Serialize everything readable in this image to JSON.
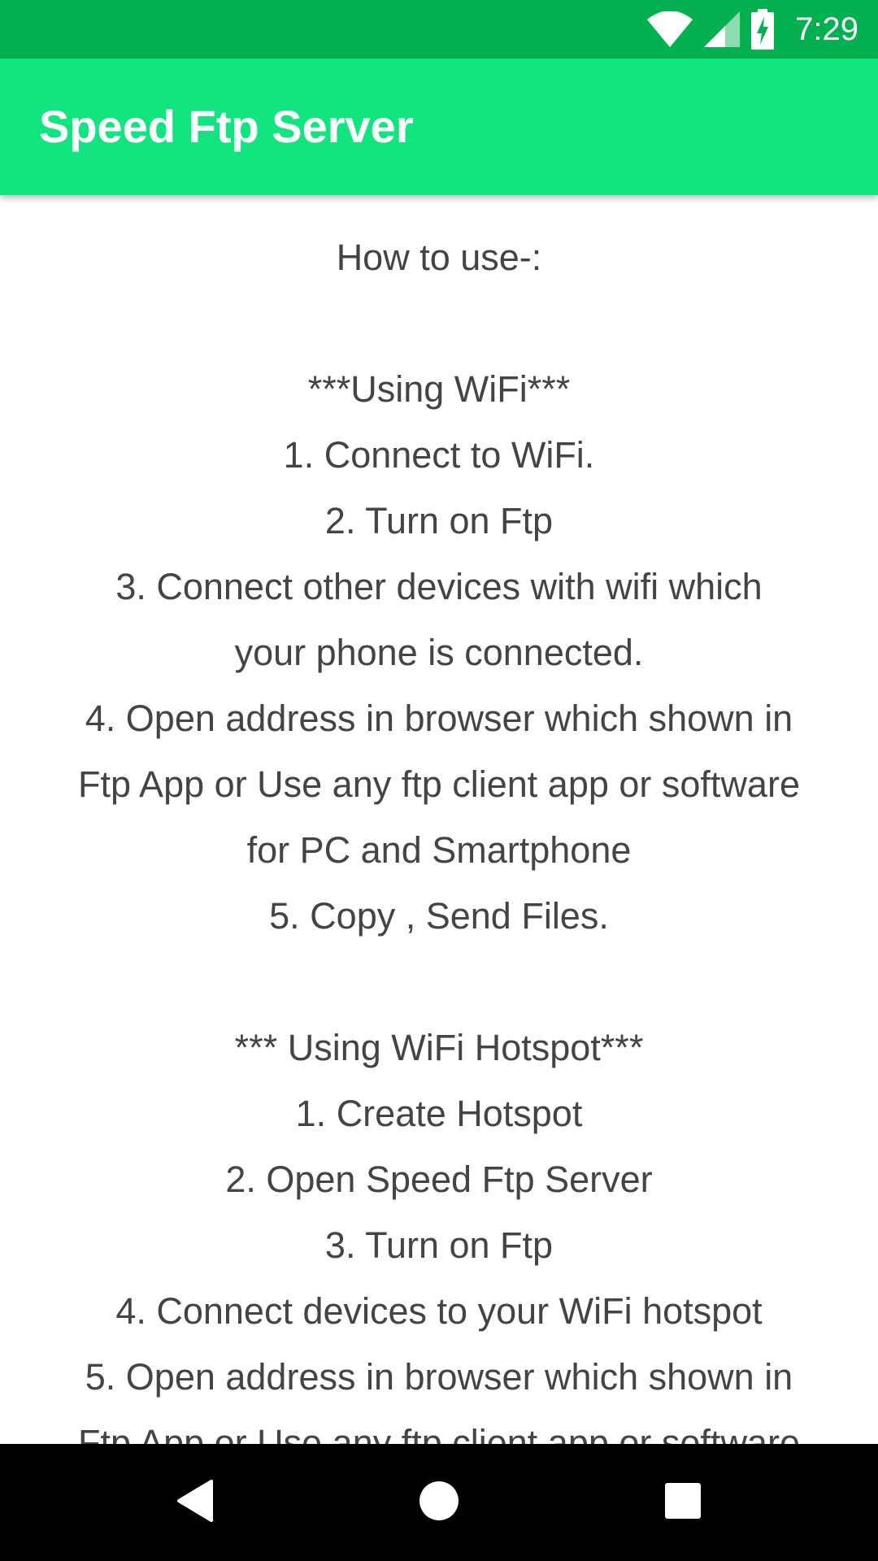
{
  "status_bar": {
    "time": "7:29",
    "icons": [
      "wifi-icon",
      "cell-signal-icon",
      "battery-charging-icon"
    ],
    "bg_color": "#05b050"
  },
  "app_bar": {
    "title": "Speed Ftp Server",
    "bg_color": "#12e57f"
  },
  "content": {
    "lines": [
      "How to use-:",
      "",
      "***Using WiFi***",
      "1. Connect to WiFi.",
      "2. Turn on Ftp",
      "3. Connect other devices with wifi which",
      "your phone is connected.",
      "4. Open address in browser which shown in",
      "Ftp App or Use any ftp client app or software",
      "for PC and Smartphone",
      "5. Copy , Send Files.",
      "",
      "*** Using WiFi Hotspot***",
      "1. Create Hotspot",
      "2. Open Speed Ftp Server",
      "3. Turn on Ftp",
      "4. Connect devices to your WiFi hotspot",
      "5. Open address in browser which shown in",
      "Ftp App or Use any ftp client app or software"
    ]
  },
  "nav_bar": {
    "buttons": [
      "back-icon",
      "home-icon",
      "recents-icon"
    ]
  }
}
